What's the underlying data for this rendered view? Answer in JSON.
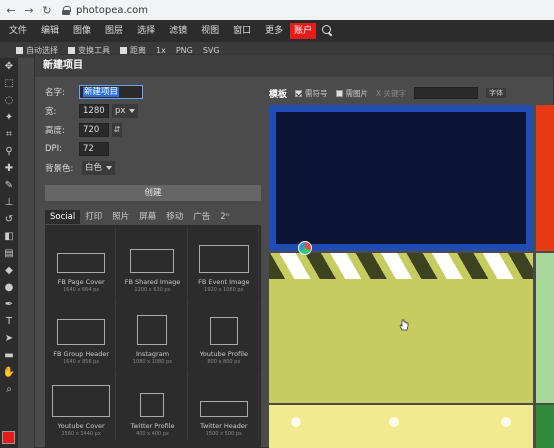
{
  "browser": {
    "url": "photopea.com"
  },
  "menubar": {
    "items": [
      "文件",
      "编辑",
      "图像",
      "图层",
      "选择",
      "滤镜",
      "视图",
      "窗口",
      "更多"
    ],
    "account": "账户"
  },
  "optionbar": {
    "items": [
      "自动选择",
      "变换工具",
      "距离",
      "1x",
      "PNG",
      "SVG"
    ]
  },
  "dialog": {
    "title": "新建项目",
    "form": {
      "name_label": "名字:",
      "name_value": "新建项目",
      "width_label": "宽:",
      "width_value": "1280",
      "width_unit": "px",
      "height_label": "高度:",
      "height_value": "720",
      "link_label": "⇵",
      "dpi_label": "DPI:",
      "dpi_value": "72",
      "bg_label": "背景色:",
      "bg_value": "白色"
    },
    "create_button": "创建",
    "tabs": [
      "Social",
      "打印",
      "照片",
      "屏幕",
      "移动",
      "广告",
      "2ⁿ"
    ],
    "templates": [
      {
        "name": "FB Page Cover",
        "size": "1640 x 664 px"
      },
      {
        "name": "FB Shared Image",
        "size": "1200 x 630 px"
      },
      {
        "name": "FB Event Image",
        "size": "1920 x 1080 px"
      },
      {
        "name": "FB Group Header",
        "size": "1640 x 856 px"
      },
      {
        "name": "Instagram",
        "size": "1080 x 1080 px"
      },
      {
        "name": "Youtube Profile",
        "size": "800 x 800 px"
      },
      {
        "name": "Youtube Cover",
        "size": "2560 x 1440 px"
      },
      {
        "name": "Twitter Profile",
        "size": "400 x 400 px"
      },
      {
        "name": "Twitter Header",
        "size": "1500 x 500 px"
      }
    ],
    "right": {
      "title": "模板",
      "opt1": "需符号",
      "opt2": "需图片",
      "keyword": "X 关键字",
      "font": "字体"
    }
  }
}
